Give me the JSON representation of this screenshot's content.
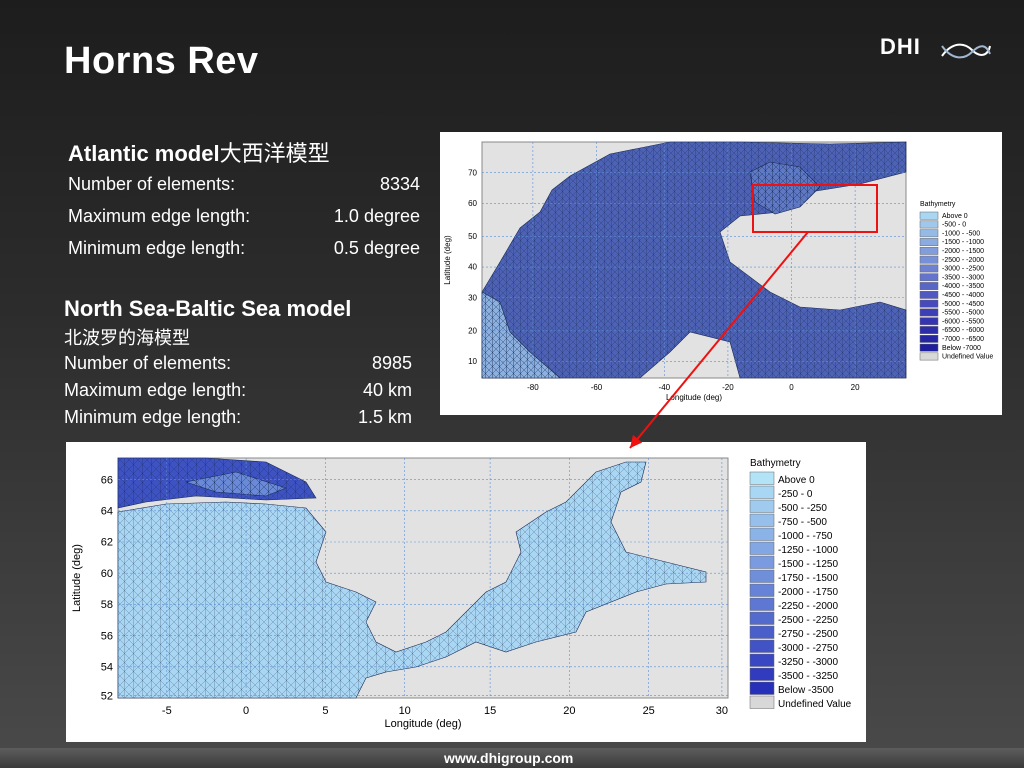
{
  "page": {
    "title": "Horns Rev",
    "logo": "DHI",
    "footer": "www.dhigroup.com"
  },
  "atlantic": {
    "heading": "Atlantic model",
    "heading_cn": "大西洋模型",
    "rows": [
      {
        "label": "Number of elements:",
        "value": "8334"
      },
      {
        "label": "Maximum edge length:",
        "value": "1.0 degree"
      },
      {
        "label": "Minimum edge length:",
        "value": "0.5 degree"
      }
    ]
  },
  "northsea": {
    "heading": "North Sea-Baltic Sea model",
    "heading_cn": "北波罗的海模型",
    "rows": [
      {
        "label": "Number of elements:",
        "value": "8985"
      },
      {
        "label": "Maximum edge length:",
        "value": "40 km"
      },
      {
        "label": "Minimum edge length:",
        "value": "1.5 km"
      }
    ]
  },
  "map_atlantic": {
    "xlabel": "Longitude (deg)",
    "ylabel": "Latitude (deg)",
    "xticks": [
      "-80",
      "-60",
      "-40",
      "-20",
      "0",
      "20"
    ],
    "yticks": [
      "10",
      "20",
      "30",
      "40",
      "50",
      "60",
      "70"
    ],
    "legend_title": "Bathymetry",
    "legend": [
      {
        "label": "Above      0",
        "color": "#a9d6f0"
      },
      {
        "label": "-500 -      0",
        "color": "#a0c8ec"
      },
      {
        "label": "-1000 -  -500",
        "color": "#96bae6"
      },
      {
        "label": "-1500 - -1000",
        "color": "#8cace0"
      },
      {
        "label": "-2000 - -1500",
        "color": "#829ddb"
      },
      {
        "label": "-2500 - -2000",
        "color": "#7890d6"
      },
      {
        "label": "-3000 - -2500",
        "color": "#6e82d1"
      },
      {
        "label": "-3500 - -3000",
        "color": "#6474cc"
      },
      {
        "label": "-4000 - -3500",
        "color": "#5a66c6"
      },
      {
        "label": "-4500 - -4000",
        "color": "#5058c1"
      },
      {
        "label": "-5000 - -4500",
        "color": "#474abb"
      },
      {
        "label": "-5500 - -5000",
        "color": "#3e3eb6"
      },
      {
        "label": "-6000 - -5500",
        "color": "#3535b0"
      },
      {
        "label": "-6500 - -6000",
        "color": "#2d2daa"
      },
      {
        "label": "-7000 - -6500",
        "color": "#2626a4"
      },
      {
        "label": "Below  -7000",
        "color": "#1f1f9c"
      },
      {
        "label": "Undefined Value",
        "color": "#d8d8d8"
      }
    ]
  },
  "map_northsea": {
    "xlabel": "Longitude (deg)",
    "ylabel": "Latitude (deg)",
    "xticks": [
      "-5",
      "0",
      "5",
      "10",
      "15",
      "20",
      "25",
      "30"
    ],
    "yticks": [
      "52",
      "54",
      "56",
      "58",
      "60",
      "62",
      "64",
      "66"
    ],
    "legend_title": "Bathymetry",
    "legend": [
      {
        "label": "Above       0",
        "color": "#b3e3f7"
      },
      {
        "label": "-250 -       0",
        "color": "#a9d7f3"
      },
      {
        "label": "-500 -  -250",
        "color": "#a0cbef"
      },
      {
        "label": "-750 -  -500",
        "color": "#96bfeb"
      },
      {
        "label": "-1000 -  -750",
        "color": "#8cb3e7"
      },
      {
        "label": "-1250 - -1000",
        "color": "#83a7e3"
      },
      {
        "label": "-1500 - -1250",
        "color": "#7a9bdf"
      },
      {
        "label": "-1750 - -1500",
        "color": "#708fdb"
      },
      {
        "label": "-2000 - -1750",
        "color": "#6683d7"
      },
      {
        "label": "-2250 - -2000",
        "color": "#5d77d2"
      },
      {
        "label": "-2500 - -2250",
        "color": "#546bce"
      },
      {
        "label": "-2750 - -2500",
        "color": "#4b5fca"
      },
      {
        "label": "-3000 - -2750",
        "color": "#4253c6"
      },
      {
        "label": "-3250 - -3000",
        "color": "#3947c2"
      },
      {
        "label": "-3500 - -3250",
        "color": "#303bbd"
      },
      {
        "label": "Below  -3500",
        "color": "#2630b8"
      },
      {
        "label": "Undefined Value",
        "color": "#d8d8d8"
      }
    ]
  }
}
